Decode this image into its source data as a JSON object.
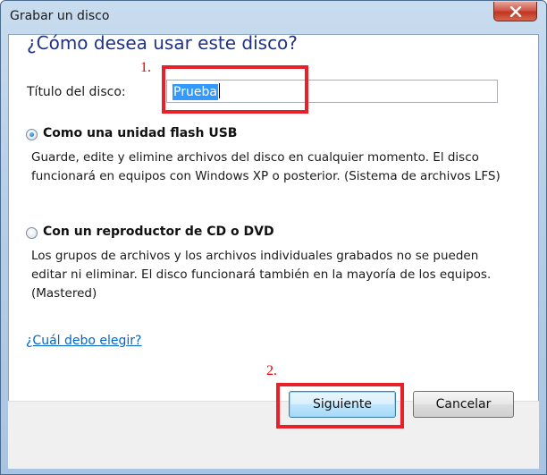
{
  "window": {
    "title": "Grabar un disco"
  },
  "dialog": {
    "heading": "¿Cómo desea usar este disco?",
    "disc_title_label": "Título del disco:",
    "disc_title_value": "Prueba",
    "options": [
      {
        "label": "Como una unidad flash USB",
        "description": "Guarde, edite y elimine archivos del disco en cualquier momento. El disco funcionará en equipos con Windows XP o posterior. (Sistema de archivos LFS)",
        "selected": true
      },
      {
        "label": "Con un reproductor de CD o DVD",
        "description": "Los grupos de archivos y los archivos individuales grabados no se pueden editar ni eliminar. El disco funcionará también en la mayoría de los equipos. (Mastered)",
        "selected": false
      }
    ],
    "help_link": "¿Cuál debo elegir?"
  },
  "buttons": {
    "next": "Siguiente",
    "cancel": "Cancelar"
  },
  "annotations": {
    "step1": "1.",
    "step2": "2.",
    "highlight_color": "#e8202a"
  },
  "icons": {
    "close": "close-icon"
  }
}
